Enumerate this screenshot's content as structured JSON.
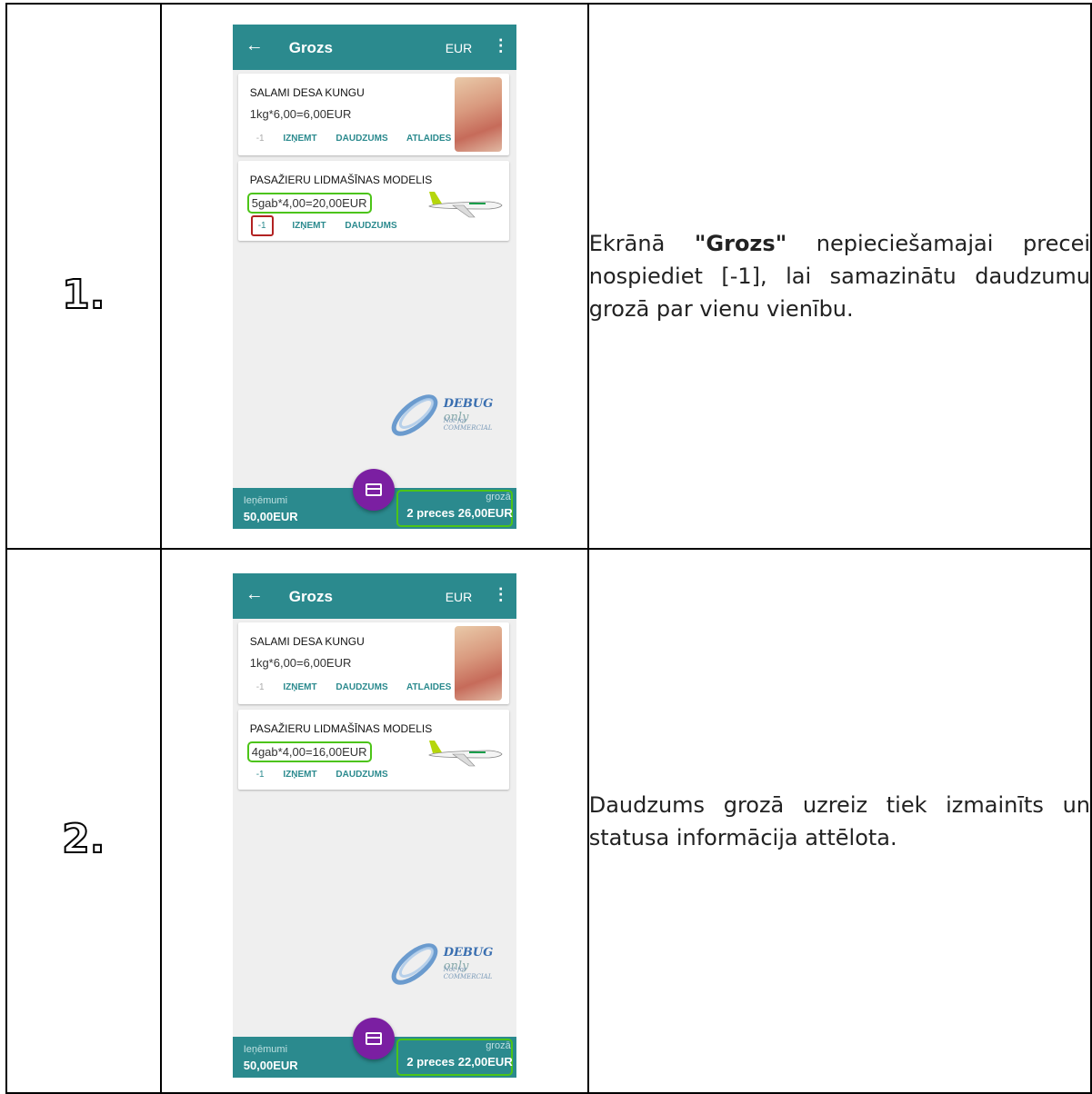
{
  "rows": [
    {
      "number": "1.",
      "description_prefix": "Ekrānā ",
      "description_bold": "\"Grozs\"",
      "description_suffix": " nepieciešamajai precei nospiediet [-1], lai samazinātu daudzumu grozā par vienu vienību.",
      "screen": {
        "title": "Grozs",
        "currency": "EUR",
        "items": [
          {
            "name": "SALAMI DESA KUNGU",
            "price_line": "1kg*6,00=6,00EUR",
            "actions": [
              "-1",
              "IZŅEMT",
              "DAUDZUMS",
              "ATLAIDES"
            ]
          },
          {
            "name": "PASAŽIERU LIDMAŠĪNAS MODELIS",
            "price_line": "5gab*4,00=20,00EUR",
            "actions": [
              "-1",
              "IZŅEMT",
              "DAUDZUMS"
            ]
          }
        ],
        "watermark": {
          "main": "DEBUG",
          "only": "only",
          "sub": "Not for COMMERCIAL"
        },
        "footer": {
          "left_label": "Ieņēmumi",
          "left_value": "50,00EUR",
          "right_label": "grozā",
          "right_value": "2 preces 26,00EUR"
        }
      }
    },
    {
      "number": "2.",
      "description": "Daudzums grozā uzreiz tiek izmainīts un statusa informācija attēlota.",
      "screen": {
        "title": "Grozs",
        "currency": "EUR",
        "items": [
          {
            "name": "SALAMI DESA KUNGU",
            "price_line": "1kg*6,00=6,00EUR",
            "actions": [
              "-1",
              "IZŅEMT",
              "DAUDZUMS",
              "ATLAIDES"
            ]
          },
          {
            "name": "PASAŽIERU LIDMAŠĪNAS MODELIS",
            "price_line": "4gab*4,00=16,00EUR",
            "actions": [
              "-1",
              "IZŅEMT",
              "DAUDZUMS"
            ]
          }
        ],
        "watermark": {
          "main": "DEBUG",
          "only": "only",
          "sub": "Not for COMMERCIAL"
        },
        "footer": {
          "left_label": "Ieņēmumi",
          "left_value": "50,00EUR",
          "right_label": "grozā",
          "right_value": "2 preces 22,00EUR"
        }
      }
    }
  ],
  "icons": {
    "back": "arrow-left-icon",
    "more": "more-vert-icon",
    "fab": "credit-card-icon"
  },
  "colors": {
    "appbar": "#2b8a8e",
    "fab": "#7b1fa2",
    "highlight_green": "#4cc417",
    "highlight_red": "#b22222"
  }
}
